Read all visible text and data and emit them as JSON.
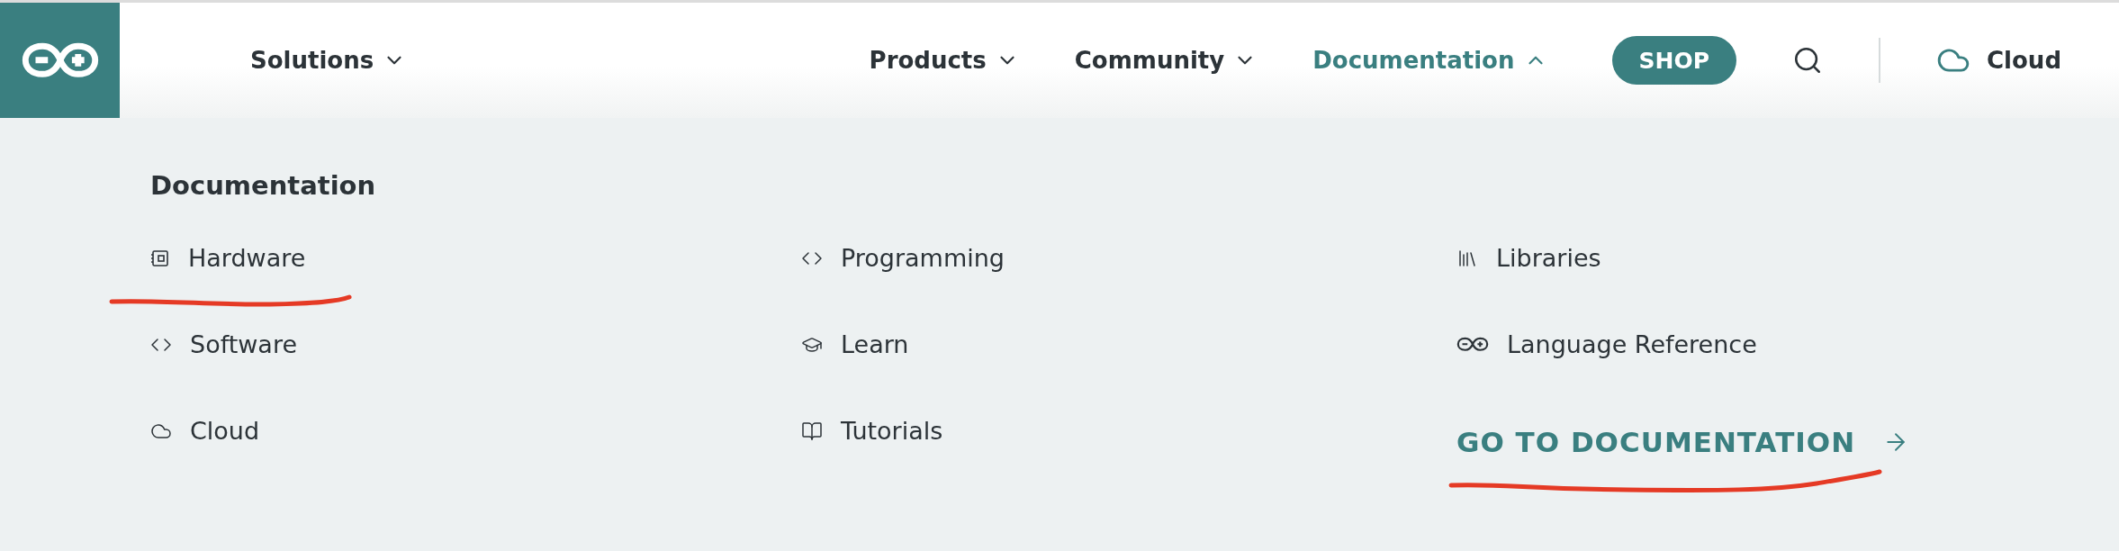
{
  "nav_left": [
    {
      "label": "Solutions",
      "expanded": false
    }
  ],
  "nav_right": [
    {
      "label": "Products",
      "expanded": false
    },
    {
      "label": "Community",
      "expanded": false
    },
    {
      "label": "Documentation",
      "expanded": true
    }
  ],
  "shop_button": "SHOP",
  "cloud_link": "Cloud",
  "menu": {
    "title": "Documentation",
    "columns": [
      [
        {
          "label": "Hardware",
          "kind": "board"
        },
        {
          "label": "Software",
          "kind": "code"
        },
        {
          "label": "Cloud",
          "kind": "cloud"
        }
      ],
      [
        {
          "label": "Programming",
          "kind": "code"
        },
        {
          "label": "Learn",
          "kind": "cap"
        },
        {
          "label": "Tutorials",
          "kind": "book"
        }
      ],
      [
        {
          "label": "Libraries",
          "kind": "books"
        },
        {
          "label": "Language Reference",
          "kind": "logo"
        },
        {
          "label": "GO TO DOCUMENTATION",
          "kind": "cta"
        }
      ]
    ]
  }
}
